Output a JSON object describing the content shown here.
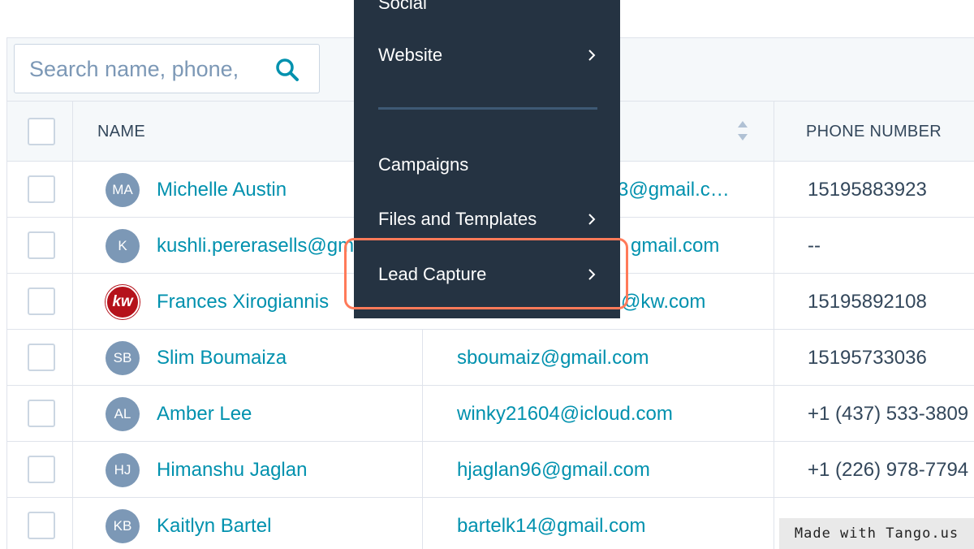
{
  "search": {
    "placeholder": "Search name, phone,"
  },
  "table": {
    "headers": {
      "name": "NAME",
      "phone": "PHONE NUMBER"
    },
    "rows": [
      {
        "initials": "MA",
        "name": "Michelle Austin",
        "email": "3@gmail.c…",
        "phone": "15195883923"
      },
      {
        "initials": "K",
        "name": "kushli.pererasells@gm",
        "email": "gmail.com",
        "phone": "--"
      },
      {
        "initials": "kw",
        "name": "Frances Xirogiannis",
        "email": "@kw.com",
        "phone": "15195892108"
      },
      {
        "initials": "SB",
        "name": "Slim Boumaiza",
        "email": "sboumaiz@gmail.com",
        "phone": "15195733036"
      },
      {
        "initials": "AL",
        "name": "Amber Lee",
        "email": "winky21604@icloud.com",
        "phone": "+1 (437) 533-3809"
      },
      {
        "initials": "HJ",
        "name": "Himanshu Jaglan",
        "email": "hjaglan96@gmail.com",
        "phone": "+1 (226) 978-7794"
      },
      {
        "initials": "KB",
        "name": "Kaitlyn Bartel",
        "email": "bartelk14@gmail.com",
        "phone": ""
      }
    ]
  },
  "menu": {
    "items": [
      {
        "label": "Social"
      },
      {
        "label": "Website"
      },
      {
        "label": "Campaigns"
      },
      {
        "label": "Files and Templates"
      },
      {
        "label": "Lead Capture"
      }
    ]
  },
  "watermark": "Made with Tango.us",
  "colors": {
    "menu_bg": "#253342",
    "link": "#0091ae",
    "highlight": "#ff7a59"
  }
}
